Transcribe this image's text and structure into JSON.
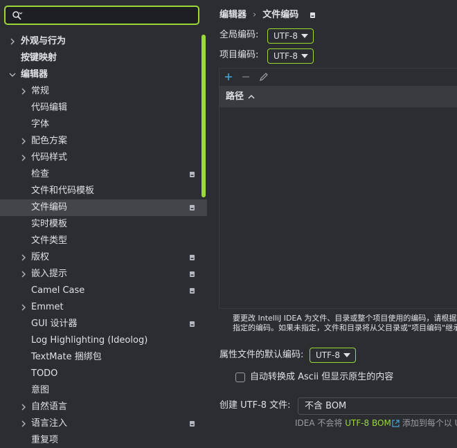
{
  "search": {
    "placeholder": ""
  },
  "tree": [
    {
      "label": "外观与行为",
      "indent": 0,
      "chevron": "right",
      "bold": true,
      "badge": false,
      "selected": false
    },
    {
      "label": "按键映射",
      "indent": 0,
      "chevron": "none",
      "bold": true,
      "badge": false,
      "selected": false
    },
    {
      "label": "编辑器",
      "indent": 0,
      "chevron": "down",
      "bold": true,
      "badge": false,
      "selected": false
    },
    {
      "label": "常规",
      "indent": 1,
      "chevron": "right",
      "bold": false,
      "badge": false,
      "selected": false
    },
    {
      "label": "代码编辑",
      "indent": 1,
      "chevron": "none",
      "bold": false,
      "badge": false,
      "selected": false
    },
    {
      "label": "字体",
      "indent": 1,
      "chevron": "none",
      "bold": false,
      "badge": false,
      "selected": false
    },
    {
      "label": "配色方案",
      "indent": 1,
      "chevron": "right",
      "bold": false,
      "badge": false,
      "selected": false
    },
    {
      "label": "代码样式",
      "indent": 1,
      "chevron": "right",
      "bold": false,
      "badge": false,
      "selected": false
    },
    {
      "label": "检查",
      "indent": 1,
      "chevron": "none",
      "bold": false,
      "badge": true,
      "selected": false
    },
    {
      "label": "文件和代码模板",
      "indent": 1,
      "chevron": "none",
      "bold": false,
      "badge": false,
      "selected": false
    },
    {
      "label": "文件编码",
      "indent": 1,
      "chevron": "none",
      "bold": false,
      "badge": true,
      "selected": true
    },
    {
      "label": "实时模板",
      "indent": 1,
      "chevron": "none",
      "bold": false,
      "badge": false,
      "selected": false
    },
    {
      "label": "文件类型",
      "indent": 1,
      "chevron": "none",
      "bold": false,
      "badge": false,
      "selected": false
    },
    {
      "label": "版权",
      "indent": 1,
      "chevron": "right",
      "bold": false,
      "badge": true,
      "selected": false
    },
    {
      "label": "嵌入提示",
      "indent": 1,
      "chevron": "right",
      "bold": false,
      "badge": true,
      "selected": false
    },
    {
      "label": "Camel Case",
      "indent": 1,
      "chevron": "none",
      "bold": false,
      "badge": true,
      "selected": false
    },
    {
      "label": "Emmet",
      "indent": 1,
      "chevron": "right",
      "bold": false,
      "badge": false,
      "selected": false
    },
    {
      "label": "GUI 设计器",
      "indent": 1,
      "chevron": "none",
      "bold": false,
      "badge": true,
      "selected": false
    },
    {
      "label": "Log Highlighting (Ideolog)",
      "indent": 1,
      "chevron": "none",
      "bold": false,
      "badge": false,
      "selected": false
    },
    {
      "label": "TextMate 捆绑包",
      "indent": 1,
      "chevron": "none",
      "bold": false,
      "badge": false,
      "selected": false
    },
    {
      "label": "TODO",
      "indent": 1,
      "chevron": "none",
      "bold": false,
      "badge": false,
      "selected": false
    },
    {
      "label": "意图",
      "indent": 1,
      "chevron": "none",
      "bold": false,
      "badge": false,
      "selected": false
    },
    {
      "label": "自然语言",
      "indent": 1,
      "chevron": "right",
      "bold": false,
      "badge": false,
      "selected": false
    },
    {
      "label": "语言注入",
      "indent": 1,
      "chevron": "right",
      "bold": false,
      "badge": true,
      "selected": false
    },
    {
      "label": "重复项",
      "indent": 1,
      "chevron": "none",
      "bold": false,
      "badge": false,
      "selected": false
    }
  ],
  "breadcrumb": {
    "parent": "编辑器",
    "separator": "›",
    "current": "文件编码"
  },
  "global_encoding": {
    "label": "全局编码:",
    "value": "UTF-8"
  },
  "project_encoding": {
    "label": "项目编码:",
    "value": "UTF-8"
  },
  "table": {
    "column_path": "路径"
  },
  "note": {
    "line1": "要更改 IntelliJ IDEA 为文件、目录或整个项目使用的编码，请根据",
    "line2": "指定的编码。如果未指定，文件和目录将从父目录或\"项目编码\"继承"
  },
  "properties": {
    "label": "属性文件的默认编码:",
    "value": "UTF-8"
  },
  "ascii_checkbox": {
    "label": "自动转换成 Ascii 但显示原生的内容",
    "checked": false
  },
  "bom": {
    "label": "创建 UTF-8 文件:",
    "value": "不含 BOM",
    "note_prefix": "IDEA 不会将 ",
    "note_link": "UTF-8 BOM",
    "note_suffix": "添加到每个以 U"
  },
  "colors": {
    "accent": "#9bd93a",
    "background": "#2b2d30",
    "selection": "#43454a",
    "text": "#dfe1e5",
    "muted": "#9a9da3"
  }
}
